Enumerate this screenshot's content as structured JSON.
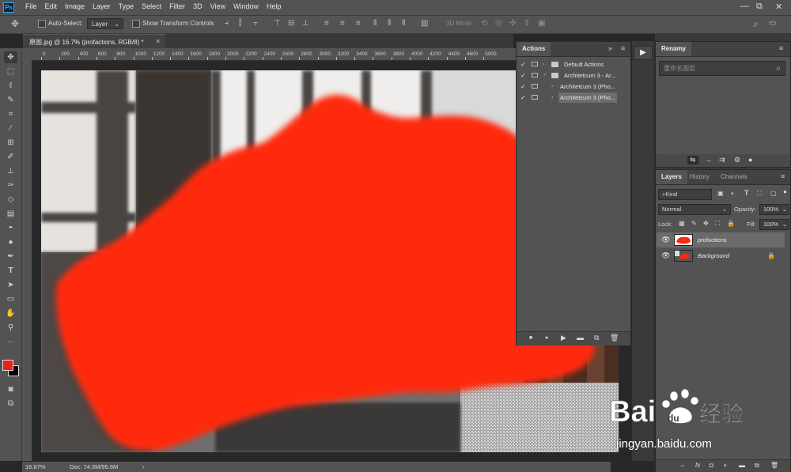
{
  "app": {
    "logo": "Ps"
  },
  "menu": {
    "items": [
      "File",
      "Edit",
      "Image",
      "Layer",
      "Type",
      "Select",
      "Filter",
      "3D",
      "View",
      "Window",
      "Help"
    ]
  },
  "window_controls": {
    "minimize": "—",
    "restore": "⧉",
    "close": "✕"
  },
  "options_bar": {
    "auto_select_label": "Auto-Select:",
    "auto_select_target": "Layer",
    "show_transform_label": "Show Transform Controls",
    "mode_3d_label": "3D Mode:"
  },
  "document": {
    "tab_title": "原图.jpg @ 16.7% (profactions, RGB/8) *",
    "close": "×"
  },
  "ruler": {
    "horizontal": [
      "0",
      "200",
      "400",
      "600",
      "800",
      "1000",
      "1200",
      "1400",
      "1600",
      "1800",
      "2000",
      "2200",
      "2400",
      "2600",
      "2800",
      "3000",
      "3200",
      "3400",
      "3600",
      "3800",
      "4000",
      "4200",
      "4400",
      "4600",
      "5000"
    ]
  },
  "status": {
    "zoom": "16.67%",
    "doc": "Doc: 74.3M/95.6M",
    "arrow": "›"
  },
  "actions_panel": {
    "tab": "Actions",
    "collapse": "»",
    "rows": [
      {
        "check": "✓",
        "label": "Default Actions",
        "twirl": "›",
        "highlight": false
      },
      {
        "check": "✓",
        "label": "Architetcum 3 - Ar...",
        "twirl": "⌄",
        "highlight": false
      },
      {
        "check": "✓",
        "label": "Architetcum 3 (Pho...",
        "twirl": "›",
        "highlight": false
      },
      {
        "check": "✓",
        "label": "Architetcum 3 (Pho...",
        "twirl": "›",
        "highlight": true
      }
    ],
    "bottom_icons": [
      "■",
      "●",
      "▶",
      "▬",
      "⧉",
      "🗑"
    ]
  },
  "play_button": "▶",
  "rename_panel": {
    "tab": "Renamy",
    "placeholder": "重命名图层",
    "icons": [
      "⇋",
      "→",
      "⇉",
      "⚙",
      "●"
    ]
  },
  "layers_panel": {
    "tabs": [
      "Layers",
      "History",
      "Channels"
    ],
    "filter": "Kind",
    "blend_mode": "Normal",
    "opacity_label": "Opacity:",
    "opacity_value": "100%",
    "lock_label": "Lock:",
    "fill_label": "Fill:",
    "fill_value": "100%",
    "layers": [
      {
        "name": "profactions",
        "visible": true,
        "locked": false
      },
      {
        "name": "Background",
        "visible": true,
        "locked": true
      }
    ],
    "bottom_icons": [
      "⇔",
      "fx",
      "◘",
      "◐",
      "▬",
      "⧉",
      "🗑"
    ]
  },
  "tools": [
    "move-icon",
    "marquee-icon",
    "lasso-icon",
    "quick-select-icon",
    "crop-icon",
    "eyedropper-icon",
    "healing-icon",
    "brush-icon",
    "stamp-icon",
    "history-brush-icon",
    "eraser-icon",
    "gradient-icon",
    "blur-icon",
    "dodge-icon",
    "pen-icon",
    "type-icon",
    "path-select-icon",
    "rectangle-icon",
    "hand-icon",
    "zoom-icon",
    "more-icon"
  ],
  "colors": {
    "foreground": "#e8231a",
    "background": "#000000",
    "paint": "#ff2a0c"
  },
  "watermark": {
    "brand": "Bai 经验",
    "url": "jingyan.baidu.com"
  }
}
